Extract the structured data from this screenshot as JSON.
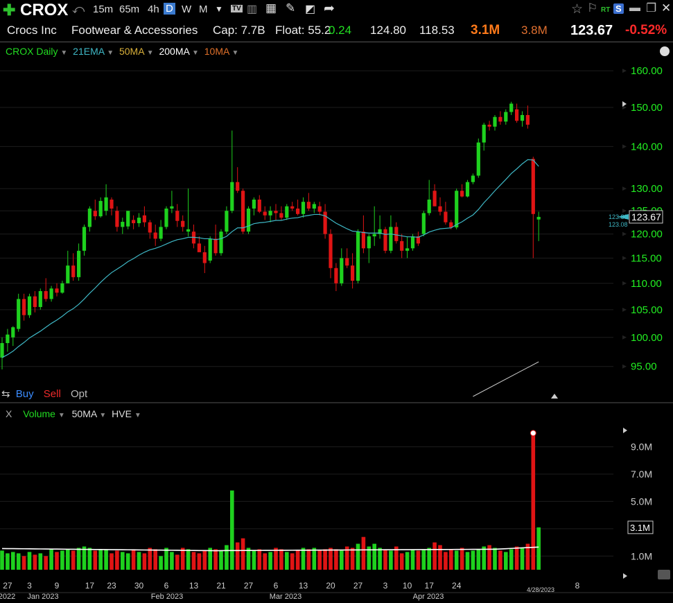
{
  "toolbar": {
    "plus_icon": "plus-icon",
    "symbol": "CROX",
    "timeframes": [
      "15m",
      "65m",
      "4h",
      "D",
      "W",
      "M"
    ],
    "active_timeframe": "D",
    "rt_label": "RT",
    "s_label": "S"
  },
  "info": {
    "company": "Crocs Inc",
    "industry": "Footwear & Accessories",
    "cap": "Cap: 7.7B",
    "float": "Float: 55.2",
    "change": "0.24",
    "high": "124.80",
    "low": "118.53",
    "volume": "3.1M",
    "avg_volume": "3.8M",
    "last": "123.67",
    "pct_change": "-0.52%"
  },
  "legend": {
    "name": "CROX Daily",
    "items": [
      {
        "label": "21EMA",
        "color": "#3fb8c6"
      },
      {
        "label": "50MA",
        "color": "#d9b03a"
      },
      {
        "label": "200MA",
        "color": "#ffffff"
      },
      {
        "label": "10MA",
        "color": "#e0702a"
      }
    ]
  },
  "trade": {
    "buy": "Buy",
    "sell": "Sell",
    "opt": "Opt"
  },
  "volume_legend": {
    "close": "X",
    "name": "Volume",
    "ma": "50MA",
    "hve": "HVE"
  },
  "colors": {
    "up": "#1ed11e",
    "down": "#e01414",
    "neutral": "#e8e8e8",
    "ema": "#3fb8c6",
    "price_axis": "#22ee22",
    "ma200": "#c8c8c8"
  },
  "chart_data": {
    "type": "candlestick",
    "price_axis": {
      "ticks": [
        "95.00",
        "100.00",
        "105.00",
        "110.00",
        "115.00",
        "120.00",
        "125.00",
        "130.00",
        "140.00",
        "150.00",
        "160.00"
      ],
      "ylim": [
        92,
        162
      ],
      "scale": "log"
    },
    "last_price_label": "123.67",
    "high_marker": "123.80",
    "low_marker": "123.08",
    "volume_axis": {
      "ticks": [
        "1.0M",
        "3.0M",
        "5.0M",
        "7.0M",
        "9.0M"
      ],
      "ylim": [
        0,
        10.5
      ],
      "unit": "M"
    },
    "last_volume_label": "3.1M",
    "x_ticks": [
      "27",
      "3",
      "9",
      "17",
      "23",
      "30",
      "6",
      "13",
      "21",
      "27",
      "6",
      "13",
      "20",
      "27",
      "3",
      "10",
      "17",
      "24",
      "8"
    ],
    "x_ticks_active": "4/28/2023",
    "x_month_labels": [
      "2022",
      "Jan 2023",
      "Feb 2023",
      "Mar 2023",
      "Apr 2023"
    ],
    "candles": [
      {
        "o": 96.5,
        "h": 100.0,
        "l": 94.5,
        "c": 99.0
      },
      {
        "o": 99.0,
        "h": 101.5,
        "l": 97.5,
        "c": 100.5
      },
      {
        "o": 100.0,
        "h": 102.0,
        "l": 98.5,
        "c": 101.8
      },
      {
        "o": 101.5,
        "h": 108.0,
        "l": 101.0,
        "c": 107.0
      },
      {
        "o": 107.0,
        "h": 108.0,
        "l": 103.0,
        "c": 104.0
      },
      {
        "o": 104.0,
        "h": 108.0,
        "l": 103.5,
        "c": 107.5
      },
      {
        "o": 107.5,
        "h": 108.5,
        "l": 104.5,
        "c": 105.5
      },
      {
        "o": 105.5,
        "h": 109.0,
        "l": 105.0,
        "c": 108.5
      },
      {
        "o": 108.5,
        "h": 111.0,
        "l": 106.5,
        "c": 107.0
      },
      {
        "o": 107.0,
        "h": 109.5,
        "l": 106.5,
        "c": 109.0
      },
      {
        "o": 109.0,
        "h": 110.0,
        "l": 107.5,
        "c": 108.2
      },
      {
        "o": 108.2,
        "h": 110.5,
        "l": 108.0,
        "c": 110.0
      },
      {
        "o": 110.0,
        "h": 116.5,
        "l": 110.0,
        "c": 113.5
      },
      {
        "o": 113.5,
        "h": 116.0,
        "l": 110.5,
        "c": 111.2
      },
      {
        "o": 111.2,
        "h": 118.0,
        "l": 110.5,
        "c": 116.5
      },
      {
        "o": 116.5,
        "h": 122.0,
        "l": 115.5,
        "c": 121.5
      },
      {
        "o": 121.5,
        "h": 126.0,
        "l": 120.5,
        "c": 125.5
      },
      {
        "o": 125.0,
        "h": 127.5,
        "l": 123.0,
        "c": 123.8
      },
      {
        "o": 123.8,
        "h": 128.0,
        "l": 123.5,
        "c": 127.2
      },
      {
        "o": 125.0,
        "h": 131.0,
        "l": 124.0,
        "c": 128.0
      },
      {
        "o": 127.5,
        "h": 128.0,
        "l": 124.0,
        "c": 125.5
      },
      {
        "o": 125.0,
        "h": 126.0,
        "l": 120.5,
        "c": 121.5
      },
      {
        "o": 121.5,
        "h": 123.5,
        "l": 120.0,
        "c": 122.6
      },
      {
        "o": 121.6,
        "h": 124.5,
        "l": 121.0,
        "c": 125.0
      },
      {
        "o": 123.0,
        "h": 124.0,
        "l": 121.0,
        "c": 122.3
      },
      {
        "o": 122.3,
        "h": 124.5,
        "l": 121.5,
        "c": 123.5
      },
      {
        "o": 124.0,
        "h": 126.0,
        "l": 121.5,
        "c": 122.5
      },
      {
        "o": 122.5,
        "h": 123.0,
        "l": 119.0,
        "c": 120.3
      },
      {
        "o": 120.3,
        "h": 122.0,
        "l": 117.5,
        "c": 119.0
      },
      {
        "o": 119.0,
        "h": 123.0,
        "l": 118.5,
        "c": 121.5
      },
      {
        "o": 121.5,
        "h": 126.0,
        "l": 121.0,
        "c": 125.5
      },
      {
        "o": 125.5,
        "h": 129.5,
        "l": 124.5,
        "c": 126.0
      },
      {
        "o": 125.0,
        "h": 126.5,
        "l": 121.5,
        "c": 122.8
      },
      {
        "o": 122.8,
        "h": 124.0,
        "l": 120.5,
        "c": 121.5
      },
      {
        "o": 120.5,
        "h": 130.0,
        "l": 119.5,
        "c": 121.0
      },
      {
        "o": 120.5,
        "h": 122.0,
        "l": 117.0,
        "c": 118.0
      },
      {
        "o": 118.0,
        "h": 119.5,
        "l": 116.5,
        "c": 116.2
      },
      {
        "o": 116.2,
        "h": 117.5,
        "l": 112.0,
        "c": 114.0
      },
      {
        "o": 114.5,
        "h": 119.5,
        "l": 114.0,
        "c": 119.0
      },
      {
        "o": 119.0,
        "h": 122.0,
        "l": 115.5,
        "c": 116.0
      },
      {
        "o": 116.0,
        "h": 121.0,
        "l": 115.5,
        "c": 120.5
      },
      {
        "o": 120.5,
        "h": 126.0,
        "l": 120.0,
        "c": 125.0
      },
      {
        "o": 125.0,
        "h": 144.0,
        "l": 124.5,
        "c": 131.5
      },
      {
        "o": 131.5,
        "h": 135.0,
        "l": 129.0,
        "c": 129.5
      },
      {
        "o": 129.5,
        "h": 130.0,
        "l": 120.0,
        "c": 120.5
      },
      {
        "o": 120.5,
        "h": 126.0,
        "l": 120.0,
        "c": 125.5
      },
      {
        "o": 125.5,
        "h": 128.0,
        "l": 124.0,
        "c": 127.5
      },
      {
        "o": 127.5,
        "h": 128.5,
        "l": 124.5,
        "c": 124.8
      },
      {
        "o": 124.8,
        "h": 126.0,
        "l": 123.0,
        "c": 124.0
      },
      {
        "o": 124.0,
        "h": 126.0,
        "l": 122.5,
        "c": 125.0
      },
      {
        "o": 125.0,
        "h": 126.5,
        "l": 123.0,
        "c": 124.5
      },
      {
        "o": 124.5,
        "h": 126.0,
        "l": 123.0,
        "c": 123.5
      },
      {
        "o": 123.5,
        "h": 126.5,
        "l": 123.0,
        "c": 126.0
      },
      {
        "o": 126.0,
        "h": 127.0,
        "l": 125.0,
        "c": 125.5
      },
      {
        "o": 125.5,
        "h": 127.5,
        "l": 124.0,
        "c": 124.3
      },
      {
        "o": 124.3,
        "h": 128.0,
        "l": 123.5,
        "c": 127.0
      },
      {
        "o": 127.0,
        "h": 129.0,
        "l": 125.0,
        "c": 125.5
      },
      {
        "o": 125.5,
        "h": 127.0,
        "l": 124.5,
        "c": 126.5
      },
      {
        "o": 126.0,
        "h": 127.0,
        "l": 124.0,
        "c": 124.8
      },
      {
        "o": 124.8,
        "h": 126.5,
        "l": 119.0,
        "c": 120.0
      },
      {
        "o": 120.0,
        "h": 121.0,
        "l": 111.0,
        "c": 113.0
      },
      {
        "o": 113.0,
        "h": 114.0,
        "l": 108.5,
        "c": 110.0
      },
      {
        "o": 110.0,
        "h": 117.0,
        "l": 109.5,
        "c": 115.0
      },
      {
        "o": 115.0,
        "h": 117.0,
        "l": 113.0,
        "c": 113.5
      },
      {
        "o": 113.5,
        "h": 116.0,
        "l": 109.0,
        "c": 110.5
      },
      {
        "o": 110.5,
        "h": 121.0,
        "l": 110.0,
        "c": 120.5
      },
      {
        "o": 120.5,
        "h": 124.0,
        "l": 116.0,
        "c": 117.0
      },
      {
        "o": 117.0,
        "h": 120.0,
        "l": 114.0,
        "c": 119.5
      },
      {
        "o": 119.5,
        "h": 126.0,
        "l": 117.5,
        "c": 120.0
      },
      {
        "o": 120.0,
        "h": 124.0,
        "l": 119.0,
        "c": 121.0
      },
      {
        "o": 121.0,
        "h": 121.5,
        "l": 116.0,
        "c": 116.5
      },
      {
        "o": 116.5,
        "h": 124.0,
        "l": 116.0,
        "c": 121.5
      },
      {
        "o": 121.5,
        "h": 122.5,
        "l": 118.0,
        "c": 118.5
      },
      {
        "o": 118.5,
        "h": 120.0,
        "l": 115.0,
        "c": 116.5
      },
      {
        "o": 116.5,
        "h": 119.5,
        "l": 115.0,
        "c": 117.0
      },
      {
        "o": 117.0,
        "h": 120.0,
        "l": 116.5,
        "c": 119.5
      },
      {
        "o": 119.5,
        "h": 120.5,
        "l": 117.5,
        "c": 118.0
      },
      {
        "o": 120.0,
        "h": 125.0,
        "l": 119.5,
        "c": 124.5
      },
      {
        "o": 124.5,
        "h": 132.0,
        "l": 124.0,
        "c": 127.5
      },
      {
        "o": 129.5,
        "h": 131.0,
        "l": 126.0,
        "c": 126.0
      },
      {
        "o": 126.0,
        "h": 128.0,
        "l": 124.0,
        "c": 124.8
      },
      {
        "o": 124.8,
        "h": 127.0,
        "l": 122.0,
        "c": 122.5
      },
      {
        "o": 122.5,
        "h": 123.0,
        "l": 121.0,
        "c": 121.4
      },
      {
        "o": 121.4,
        "h": 130.0,
        "l": 121.0,
        "c": 129.5
      },
      {
        "o": 129.5,
        "h": 131.0,
        "l": 128.0,
        "c": 128.2
      },
      {
        "o": 128.2,
        "h": 132.0,
        "l": 128.0,
        "c": 131.5
      },
      {
        "o": 131.5,
        "h": 133.5,
        "l": 131.0,
        "c": 133.0
      },
      {
        "o": 133.0,
        "h": 142.0,
        "l": 132.5,
        "c": 141.0
      },
      {
        "o": 141.0,
        "h": 146.0,
        "l": 139.0,
        "c": 145.5
      },
      {
        "o": 145.5,
        "h": 146.5,
        "l": 144.0,
        "c": 145.0
      },
      {
        "o": 145.0,
        "h": 148.0,
        "l": 144.0,
        "c": 147.5
      },
      {
        "o": 147.5,
        "h": 149.0,
        "l": 145.5,
        "c": 146.3
      },
      {
        "o": 146.3,
        "h": 149.5,
        "l": 145.5,
        "c": 148.8
      },
      {
        "o": 148.8,
        "h": 151.5,
        "l": 148.0,
        "c": 151.0
      },
      {
        "o": 149.5,
        "h": 151.0,
        "l": 146.0,
        "c": 146.5
      },
      {
        "o": 146.5,
        "h": 149.0,
        "l": 145.0,
        "c": 148.0
      },
      {
        "o": 148.0,
        "h": 150.5,
        "l": 144.5,
        "c": 145.5
      },
      {
        "o": 137.0,
        "h": 137.5,
        "l": 115.0,
        "c": 124.3
      },
      {
        "o": 123.1,
        "h": 124.8,
        "l": 118.5,
        "c": 123.67
      }
    ],
    "ema21": [
      96.5,
      97.0,
      97.6,
      98.4,
      99.1,
      99.9,
      100.5,
      101.1,
      101.8,
      102.5,
      103.1,
      103.8,
      104.6,
      105.2,
      106.0,
      107.0,
      108.1,
      109.1,
      110.2,
      111.2,
      112.1,
      112.8,
      113.5,
      114.3,
      114.9,
      115.6,
      116.2,
      116.7,
      117.0,
      117.4,
      117.9,
      118.4,
      118.8,
      119.0,
      119.3,
      119.3,
      119.2,
      119.0,
      119.0,
      118.8,
      119.0,
      119.5,
      120.5,
      121.3,
      121.3,
      121.7,
      122.2,
      122.4,
      122.5,
      122.7,
      122.9,
      122.9,
      123.2,
      123.4,
      123.5,
      123.8,
      124.0,
      124.2,
      124.2,
      123.9,
      123.1,
      122.3,
      121.7,
      121.1,
      120.6,
      120.5,
      120.3,
      120.2,
      120.2,
      120.2,
      119.9,
      120.0,
      119.8,
      119.6,
      119.4,
      119.4,
      119.3,
      119.8,
      120.4,
      120.8,
      121.1,
      121.2,
      121.3,
      122.0,
      122.6,
      123.4,
      124.1,
      125.3,
      126.8,
      128.1,
      129.5,
      130.8,
      132.1,
      133.5,
      134.6,
      135.8,
      136.8,
      136.7,
      135.2
    ]
  },
  "volumes": [
    1.4,
    1.2,
    1.3,
    1.2,
    1.0,
    1.3,
    1.1,
    1.2,
    1.0,
    1.5,
    1.3,
    1.4,
    1.5,
    1.4,
    1.6,
    1.7,
    1.6,
    1.4,
    1.5,
    1.5,
    1.2,
    1.4,
    1.3,
    1.2,
    1.5,
    1.3,
    1.2,
    1.6,
    1.5,
    1.0,
    1.6,
    1.3,
    1.1,
    1.6,
    1.5,
    1.3,
    1.2,
    1.4,
    1.6,
    1.5,
    1.4,
    1.8,
    5.8,
    2.0,
    2.3,
    1.6,
    1.4,
    1.5,
    1.2,
    1.3,
    1.6,
    1.5,
    1.3,
    1.2,
    1.4,
    1.6,
    1.5,
    1.6,
    1.4,
    1.5,
    1.6,
    1.5,
    1.4,
    1.7,
    1.6,
    1.9,
    2.4,
    1.7,
    1.9,
    1.6,
    1.5,
    1.4,
    1.7,
    1.2,
    1.3,
    1.5,
    1.4,
    1.5,
    1.6,
    2.0,
    1.8,
    1.3,
    1.5,
    1.4,
    1.6,
    1.3,
    1.4,
    1.5,
    1.7,
    1.8,
    1.6,
    1.4,
    1.3,
    1.5,
    1.7,
    1.6,
    1.9,
    10.0,
    3.1
  ]
}
